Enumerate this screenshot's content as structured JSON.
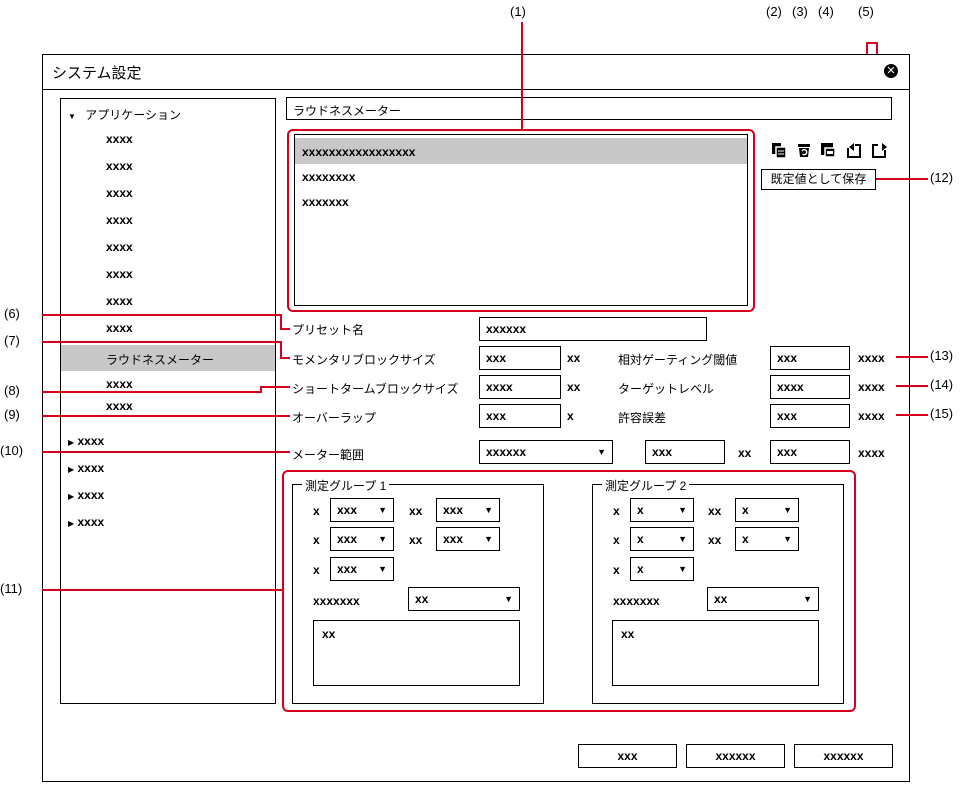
{
  "window": {
    "title": "システム設定",
    "close_icon": "close-icon"
  },
  "tree": {
    "root_label": "アプリケーション",
    "children": [
      "xxxx",
      "xxxx",
      "xxxx",
      "xxxx",
      "xxxx",
      "xxxx",
      "xxxx",
      "xxxx"
    ],
    "selected_label": "ラウドネスメーター",
    "after_selected": [
      "xxxx",
      "xxxx"
    ],
    "collapsed": [
      "xxxx",
      "xxxx",
      "xxxx",
      "xxxx"
    ]
  },
  "section": {
    "title": "ラウドネスメーター"
  },
  "preset_list": [
    "xxxxxxxxxxxxxxxxx",
    "xxxxxxxx",
    "xxxxxxx"
  ],
  "toolbar": {
    "save_default_label": "既定値として保存"
  },
  "form": {
    "preset_name": {
      "label": "プリセット名",
      "value": "xxxxxx"
    },
    "momentary": {
      "label": "モメンタリブロックサイズ",
      "value": "xxx",
      "unit": "xx"
    },
    "shortterm": {
      "label": "ショートタームブロックサイズ",
      "value": "xxxx",
      "unit": "xx"
    },
    "overlap": {
      "label": "オーバーラップ",
      "value": "xxx",
      "unit": "x"
    },
    "meter_range": {
      "label": "メーター範囲",
      "value": "xxxxxx",
      "value2": "xxx",
      "unit2": "xx",
      "value3": "xxx",
      "unit3": "xxxx"
    },
    "gating": {
      "label": "相対ゲーティング閾値",
      "value": "xxx",
      "unit": "xxxx"
    },
    "target": {
      "label": "ターゲットレベル",
      "value": "xxxx",
      "unit": "xxxx"
    },
    "tolerance": {
      "label": "許容誤差",
      "value": "xxx",
      "unit": "xxxx"
    }
  },
  "group1": {
    "title": "測定グループ 1",
    "row1": {
      "l1": "x",
      "v1": "xxx",
      "l2": "xx",
      "v2": "xxx"
    },
    "row2": {
      "l1": "x",
      "v1": "xxx",
      "l2": "xx",
      "v2": "xxx"
    },
    "row3": {
      "l1": "x",
      "v1": "xxx"
    },
    "sel": {
      "label": "xxxxxxx",
      "value": "xx"
    },
    "memo": "xx"
  },
  "group2": {
    "title": "測定グループ 2",
    "row1": {
      "l1": "x",
      "v1": "x",
      "l2": "xx",
      "v2": "x"
    },
    "row2": {
      "l1": "x",
      "v1": "x",
      "l2": "xx",
      "v2": "x"
    },
    "row3": {
      "l1": "x",
      "v1": "x"
    },
    "sel": {
      "label": "xxxxxxx",
      "value": "xx"
    },
    "memo": "xx"
  },
  "buttons": {
    "b1": "xxx",
    "b2": "xxxxxx",
    "b3": "xxxxxx"
  },
  "callouts": {
    "c1": "(1)",
    "c2": "(2)",
    "c3": "(3)",
    "c4": "(4)",
    "c5": "(5)",
    "c6": "(6)",
    "c7": "(7)",
    "c8": "(8)",
    "c9": "(9)",
    "c10": "(10)",
    "c11": "(11)",
    "c12": "(12)",
    "c13": "(13)",
    "c14": "(14)",
    "c15": "(15)"
  },
  "colors": {
    "callout": "#d4001e",
    "selection": "#c8c8c8"
  }
}
